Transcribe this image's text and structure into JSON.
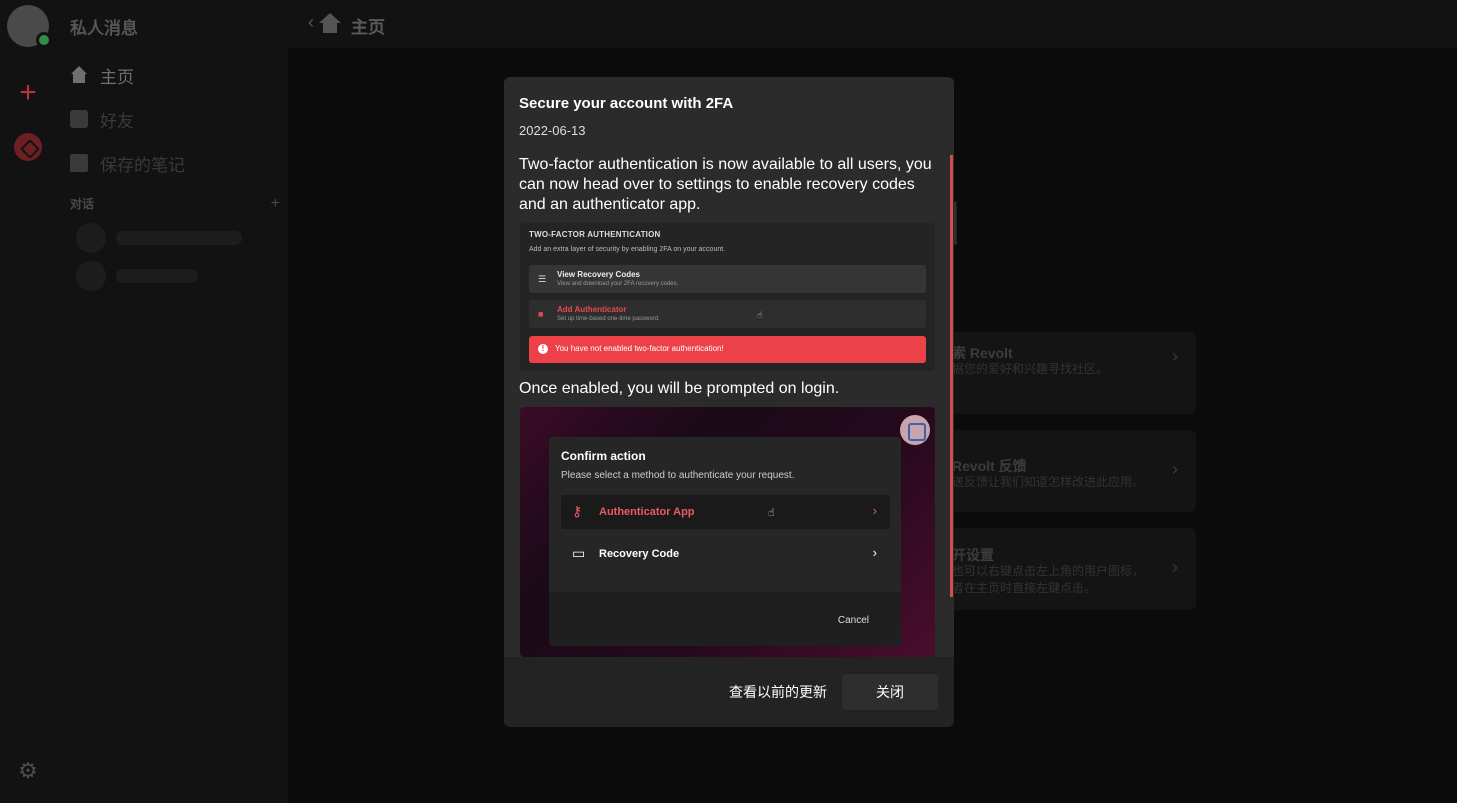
{
  "sidebar": {
    "header": "私人消息",
    "items": [
      {
        "label": "主页"
      },
      {
        "label": "好友"
      },
      {
        "label": "保存的笔记"
      }
    ],
    "section_title": "对话",
    "section_add": "+"
  },
  "topbar": {
    "back": "‹",
    "title": "主页"
  },
  "home_cards": [
    {
      "title": "索 Revolt",
      "desc": "据您的爱好和兴趣寻找社区。",
      "chevron": "›"
    },
    {
      "title": "Revolt 反馈",
      "desc": "送反馈让我们知道怎样改进此应用。",
      "chevron": "›"
    },
    {
      "title": "开设置",
      "desc": "也可以右键点击左上角的用户图标，\n者在主页时直接左键点击。",
      "chevron": "›"
    }
  ],
  "home_big_glyph": "]",
  "rail": {
    "plus": "+",
    "gear": "⚙"
  },
  "modal": {
    "title": "Secure your account with 2FA",
    "date": "2022-06-13",
    "paragraph1": "Two-factor authentication is now available to all users, you can now head over to settings to enable recovery codes and an authenticator app.",
    "paragraph2": "Once enabled, you will be prompted on login.",
    "image1": {
      "heading": "TWO-FACTOR AUTHENTICATION",
      "subheading": "Add an extra layer of security by enabling 2FA on your account.",
      "row1_title": "View Recovery Codes",
      "row1_desc": "View and download your 2FA recovery codes.",
      "row2_title": "Add Authenticator",
      "row2_desc": "Set up time-based one-time password.",
      "alert": "You have not enabled two-factor authentication!"
    },
    "image2": {
      "title": "Confirm action",
      "desc": "Please select a method to authenticate your request.",
      "option1": "Authenticator App",
      "option2": "Recovery Code",
      "cancel": "Cancel"
    },
    "btn_prev": "查看以前的更新",
    "btn_close": "关闭"
  }
}
